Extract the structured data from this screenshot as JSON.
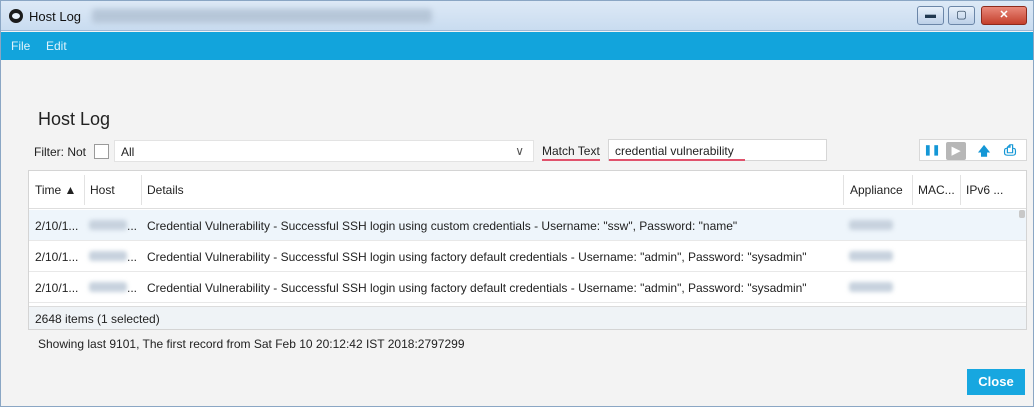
{
  "window": {
    "title": "Host Log",
    "controls": {
      "minimize": "▬",
      "maximize": "▢",
      "close": "✕"
    }
  },
  "menu": {
    "items": [
      "File",
      "Edit"
    ]
  },
  "page": {
    "heading": "Host Log"
  },
  "filter": {
    "label": "Filter:  Not",
    "not_checked": false,
    "selected": "All"
  },
  "match": {
    "label": "Match Text",
    "value": "credential vulnerability"
  },
  "toolbar": {
    "pause": "❚❚",
    "play": "▶",
    "up": "🡅",
    "print": "⎙"
  },
  "table": {
    "columns": [
      "Time ▲",
      "Host",
      "Details",
      "Appliance",
      "MAC...",
      "IPv6 ..."
    ],
    "rows": [
      {
        "time": "2/10/1...",
        "host_suffix": "...",
        "details": "Credential Vulnerability - Successful SSH login using custom credentials - Username: \"ssw\", Password: \"name\"",
        "selected": true
      },
      {
        "time": "2/10/1...",
        "host_suffix": "...",
        "details": "Credential Vulnerability - Successful SSH login using factory default credentials - Username: \"admin\", Password: \"sysadmin\"",
        "selected": false
      },
      {
        "time": "2/10/1...",
        "host_suffix": "...",
        "details": "Credential Vulnerability - Successful SSH login using factory default credentials - Username: \"admin\", Password: \"sysadmin\"",
        "selected": false
      }
    ],
    "footer": "2648 items (1 selected)"
  },
  "status": {
    "showing": "Showing last 9101, The first record from Sat Feb 10 20:12:42 IST 2018:2797299"
  },
  "buttons": {
    "close": "Close"
  },
  "colors": {
    "accent": "#12a4dc",
    "close_button": "#17a7e0",
    "match_underline": "#e0526c"
  }
}
